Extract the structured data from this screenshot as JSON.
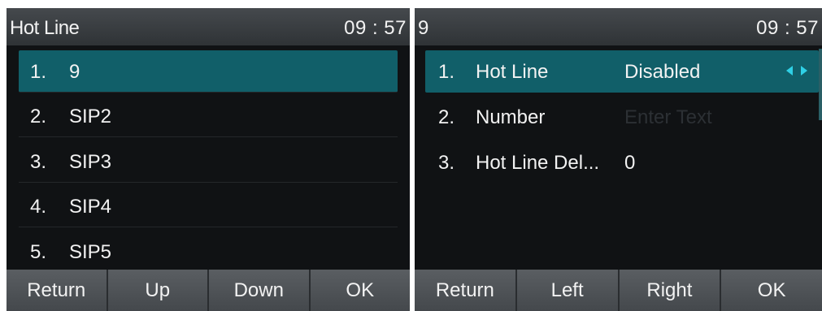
{
  "left_screen": {
    "title": "Hot Line",
    "time": "09 : 57",
    "items": [
      {
        "num": "1.",
        "label": "9",
        "selected": true
      },
      {
        "num": "2.",
        "label": "SIP2"
      },
      {
        "num": "3.",
        "label": "SIP3"
      },
      {
        "num": "4.",
        "label": "SIP4"
      },
      {
        "num": "5.",
        "label": "SIP5"
      }
    ],
    "softkeys": [
      "Return",
      "Up",
      "Down",
      "OK"
    ]
  },
  "right_screen": {
    "title": "9",
    "time": "09 : 57",
    "items": [
      {
        "num": "1.",
        "label": "Hot Line",
        "value": "Disabled",
        "selected": true,
        "control": "left-right-arrows-icon"
      },
      {
        "num": "2.",
        "label": "Number",
        "placeholder": "Enter Text"
      },
      {
        "num": "3.",
        "label": "Hot Line Del...",
        "value": "0"
      }
    ],
    "softkeys": [
      "Return",
      "Left",
      "Right",
      "OK"
    ]
  },
  "colors": {
    "selection": "#115f69",
    "screen_bg": "#101214",
    "arrow_accent": "#2fd0e6"
  }
}
